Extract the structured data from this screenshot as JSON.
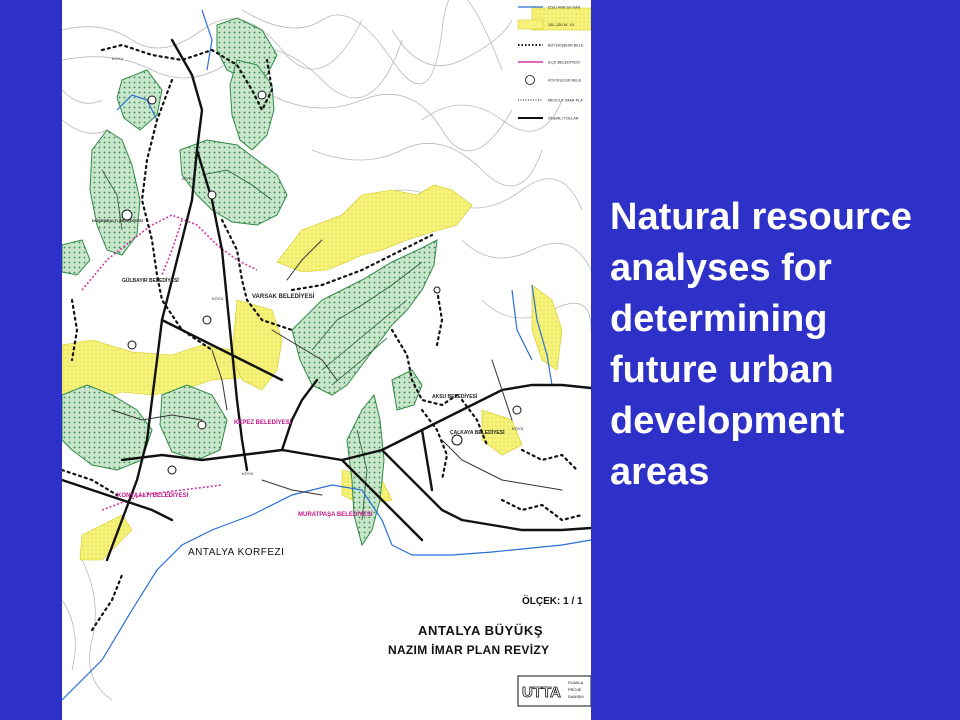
{
  "colors": {
    "slide_background": "#2e31c8",
    "map_background": "#ffffff",
    "forest_green": "#2f8a45",
    "forest_fill": "#c9e6cd",
    "agriculture_yellow": "#f6f37a",
    "road_black": "#111111",
    "boundary_pink": "#d4379c",
    "water_blue": "#2a6fd6",
    "contour_gray": "#b9b9b9",
    "text_white": "#ffffff"
  },
  "slide_text": {
    "line1": "Natural resource",
    "line2": "analyses for",
    "line3": "determining",
    "line4": "future urban",
    "line5": "development",
    "line6": "areas"
  },
  "map": {
    "title_line1": "ANTALYA BÜYÜKŞ",
    "title_line2": "NAZIM İMAR PLAN REVİZY",
    "scale_label": "ÖLÇEK: 1 / 1",
    "sea_label": "ANTALYA KORFEZI",
    "logo_text": "UTTA",
    "logo_sub": [
      "PLANLA",
      "PROJE",
      "DANIŞM"
    ],
    "legend": [
      {
        "icon": "line-blue",
        "text": "IZSU ANA SU KAN"
      },
      {
        "icon": "fill-yellow",
        "text": "150–250 M. YU"
      },
      {
        "icon": "dotted-thick",
        "text": "BÜYÜKŞEHIR BELE"
      },
      {
        "icon": "line-pink",
        "text": "ILÇE BELEDIYESI"
      },
      {
        "icon": "circle",
        "text": "KÖY/KUCUK BELE"
      },
      {
        "icon": "dotted-thin",
        "text": "MEVCUT İMAR PLA"
      },
      {
        "icon": "line-thick",
        "text": "ÖNEMLI YOLLAR"
      }
    ],
    "places": [
      {
        "id": "varsak",
        "text": "VARSAK BELEDİYESİ"
      },
      {
        "id": "kepez",
        "text": "KEPEZ BELEDİYESİ"
      },
      {
        "id": "konyaalti",
        "text": "KONYAALTI BELEDİYESİ"
      },
      {
        "id": "muratpasa",
        "text": "MURATPAŞA BELEDİYESİ"
      },
      {
        "id": "aksu",
        "text": "AKSU BELEDİYESİ"
      },
      {
        "id": "calkaya",
        "text": "ÇALKAYA BELEDİYESİ"
      },
      {
        "id": "gulbayir",
        "text": "GÜLBAYIR BELEDİYESİ"
      },
      {
        "id": "dosemealti",
        "text": "DÖŞEMEALTI BELEDİYESİ"
      }
    ]
  }
}
